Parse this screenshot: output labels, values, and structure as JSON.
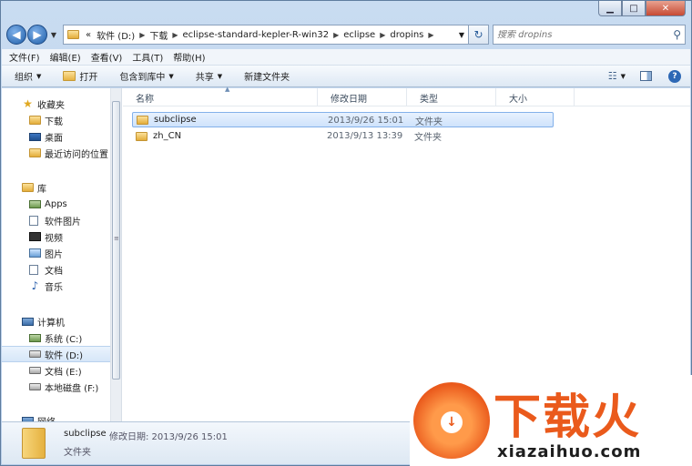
{
  "window": {
    "caption": {
      "minimize": "▁",
      "maximize": "□",
      "close": "✕"
    }
  },
  "address": {
    "back": "◀",
    "forward": "▶",
    "prefix": "«",
    "crumbs": [
      "软件 (D:)",
      "下载",
      "eclipse-standard-kepler-R-win32",
      "eclipse",
      "dropins"
    ],
    "refresh": "↻",
    "search_placeholder": "搜索 dropins"
  },
  "menubar": [
    "文件(F)",
    "编辑(E)",
    "查看(V)",
    "工具(T)",
    "帮助(H)"
  ],
  "toolbar": {
    "organize": "组织",
    "open": "打开",
    "include_library": "包含到库中",
    "share": "共享",
    "new_folder": "新建文件夹"
  },
  "nav": {
    "favorites": {
      "header": "收藏夹",
      "items": [
        "下载",
        "桌面",
        "最近访问的位置"
      ]
    },
    "libraries": {
      "header": "库",
      "items": [
        "Apps",
        "软件图片",
        "视频",
        "图片",
        "文档",
        "音乐"
      ]
    },
    "computer": {
      "header": "计算机",
      "items": [
        "系统 (C:)",
        "软件 (D:)",
        "文档 (E:)",
        "本地磁盘 (F:)"
      ]
    },
    "network": {
      "header": "网络"
    }
  },
  "columns": {
    "name": "名称",
    "modified": "修改日期",
    "type": "类型",
    "size": "大小"
  },
  "files": [
    {
      "name": "subclipse",
      "modified": "2013/9/26 15:01",
      "type": "文件夹",
      "size": ""
    },
    {
      "name": "zh_CN",
      "modified": "2013/9/13 13:39",
      "type": "文件夹",
      "size": ""
    }
  ],
  "details": {
    "name": "subclipse",
    "meta": "修改日期: 2013/9/26 15:01",
    "type": "文件夹"
  },
  "watermark": {
    "title": "下载火",
    "url": "xiazaihuo.com",
    "accent": "#ea5a1c"
  },
  "colors": {
    "selection": "#cfe3fb",
    "selection_border": "#83b1ea",
    "frame": "#b7cde8"
  }
}
